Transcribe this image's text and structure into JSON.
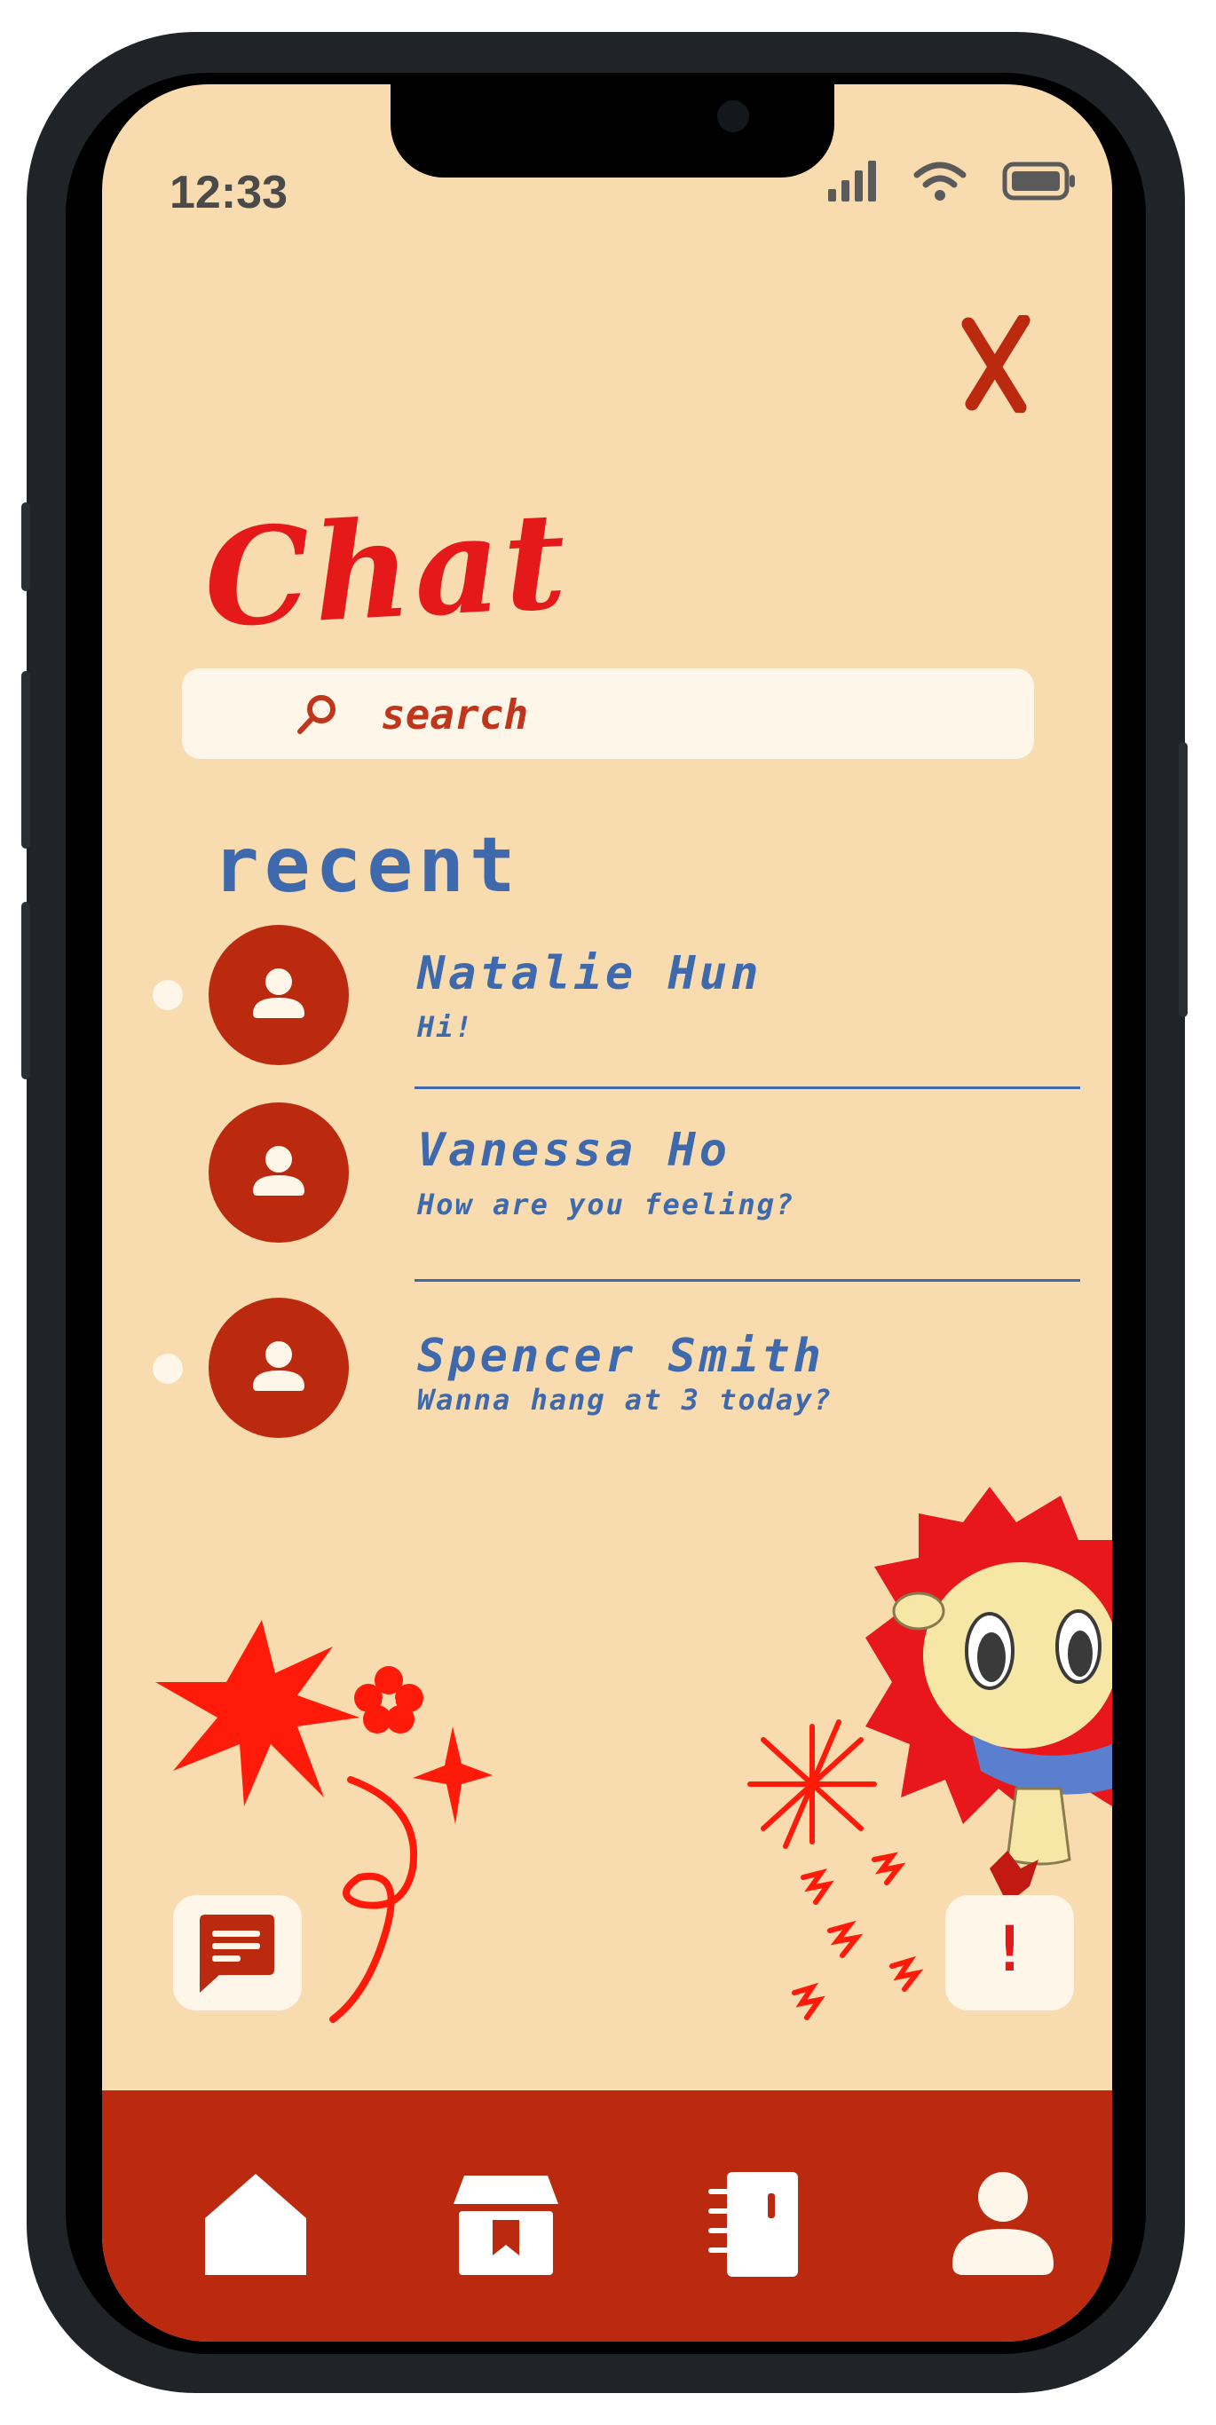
{
  "status_bar": {
    "time": "12:33"
  },
  "header": {
    "title": "Chat",
    "close_label": "X"
  },
  "search": {
    "placeholder": "search"
  },
  "recent": {
    "heading": "recent",
    "conversations": [
      {
        "name": "Natalie Hun",
        "preview": "Hi!",
        "unread": true
      },
      {
        "name": "Vanessa Ho",
        "preview": "How are you feeling?",
        "unread": false
      },
      {
        "name": "Spencer Smith",
        "preview": "Wanna hang at 3 today?",
        "unread": true
      }
    ]
  },
  "actions": {
    "alert_label": "!"
  },
  "colors": {
    "background": "#f8dbae",
    "accent_red": "#bb2a0f",
    "text_blue": "#3e6aad",
    "card": "#fdf6e9"
  },
  "icons": {
    "signal": "signal-icon",
    "wifi": "wifi-icon",
    "battery": "battery-icon",
    "search": "search-icon",
    "message": "message-icon",
    "home": "home-icon",
    "shop": "shop-icon",
    "notebook": "notebook-icon",
    "profile": "profile-icon"
  }
}
